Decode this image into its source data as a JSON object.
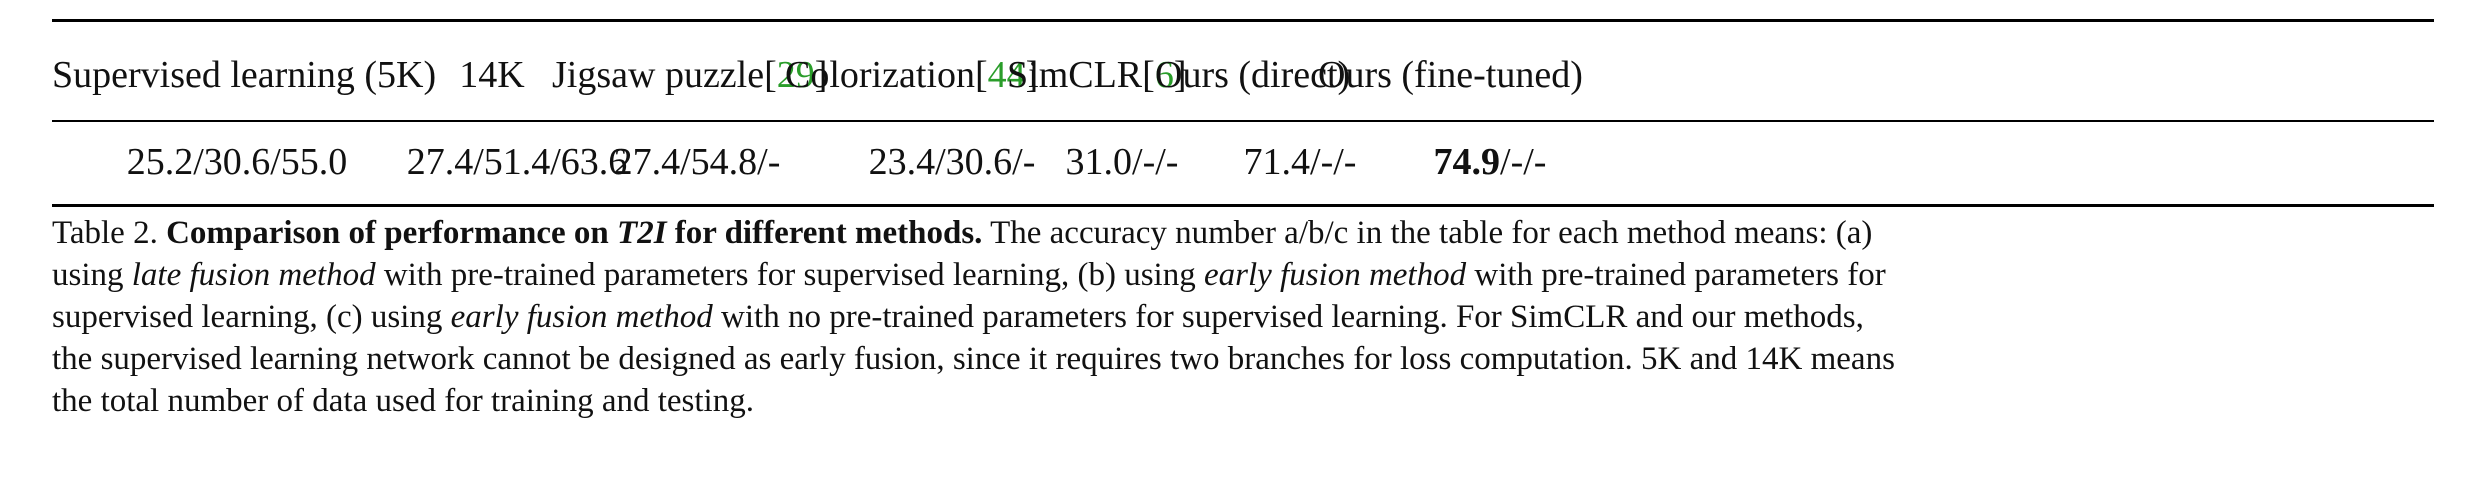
{
  "table": {
    "headers": [
      {
        "text": "Supervised learning (5K)",
        "cite": ""
      },
      {
        "text": "14K",
        "cite": ""
      },
      {
        "text": "Jigsaw puzzle[",
        "cite": "29",
        "suffix": "]"
      },
      {
        "text": "Colorization[",
        "cite": "44",
        "suffix": "]"
      },
      {
        "text": "SimCLR[",
        "cite": "6",
        "suffix": "]"
      },
      {
        "text": "Ours (direct)",
        "cite": ""
      },
      {
        "text": "Ours (fine-tuned)",
        "cite": ""
      }
    ],
    "row": [
      {
        "value": "25.2/30.6/55.0"
      },
      {
        "value": "27.4/51.4/63.6"
      },
      {
        "value": "27.4/54.8/-"
      },
      {
        "value": "23.4/30.6/-"
      },
      {
        "value": "31.0/-/-"
      },
      {
        "value": "71.4/-/-"
      },
      {
        "bold": "74.9",
        "rest": "/-/-"
      }
    ]
  },
  "caption": {
    "label": "Table 2.",
    "title_a": "Comparison of performance on",
    "title_em": "T2I",
    "title_b": "for different methods.",
    "l1": "The accuracy number a/b/c in the table for each method means: (a)",
    "l2a": "using",
    "l2em": "late fusion method",
    "l2b": "with pre-trained parameters for supervised learning, (b) using",
    "l2em2": "early fusion method",
    "l2c": "with pre-trained parameters for",
    "l3a": "supervised learning, (c) using",
    "l3em": "early fusion method",
    "l3b": "with no pre-trained parameters for supervised learning. For SimCLR and our methods,",
    "l4": "the supervised learning network cannot be designed as early fusion, since it requires two branches for loss computation. 5K and 14K means",
    "l5": "the total number of data used for training and testing."
  }
}
